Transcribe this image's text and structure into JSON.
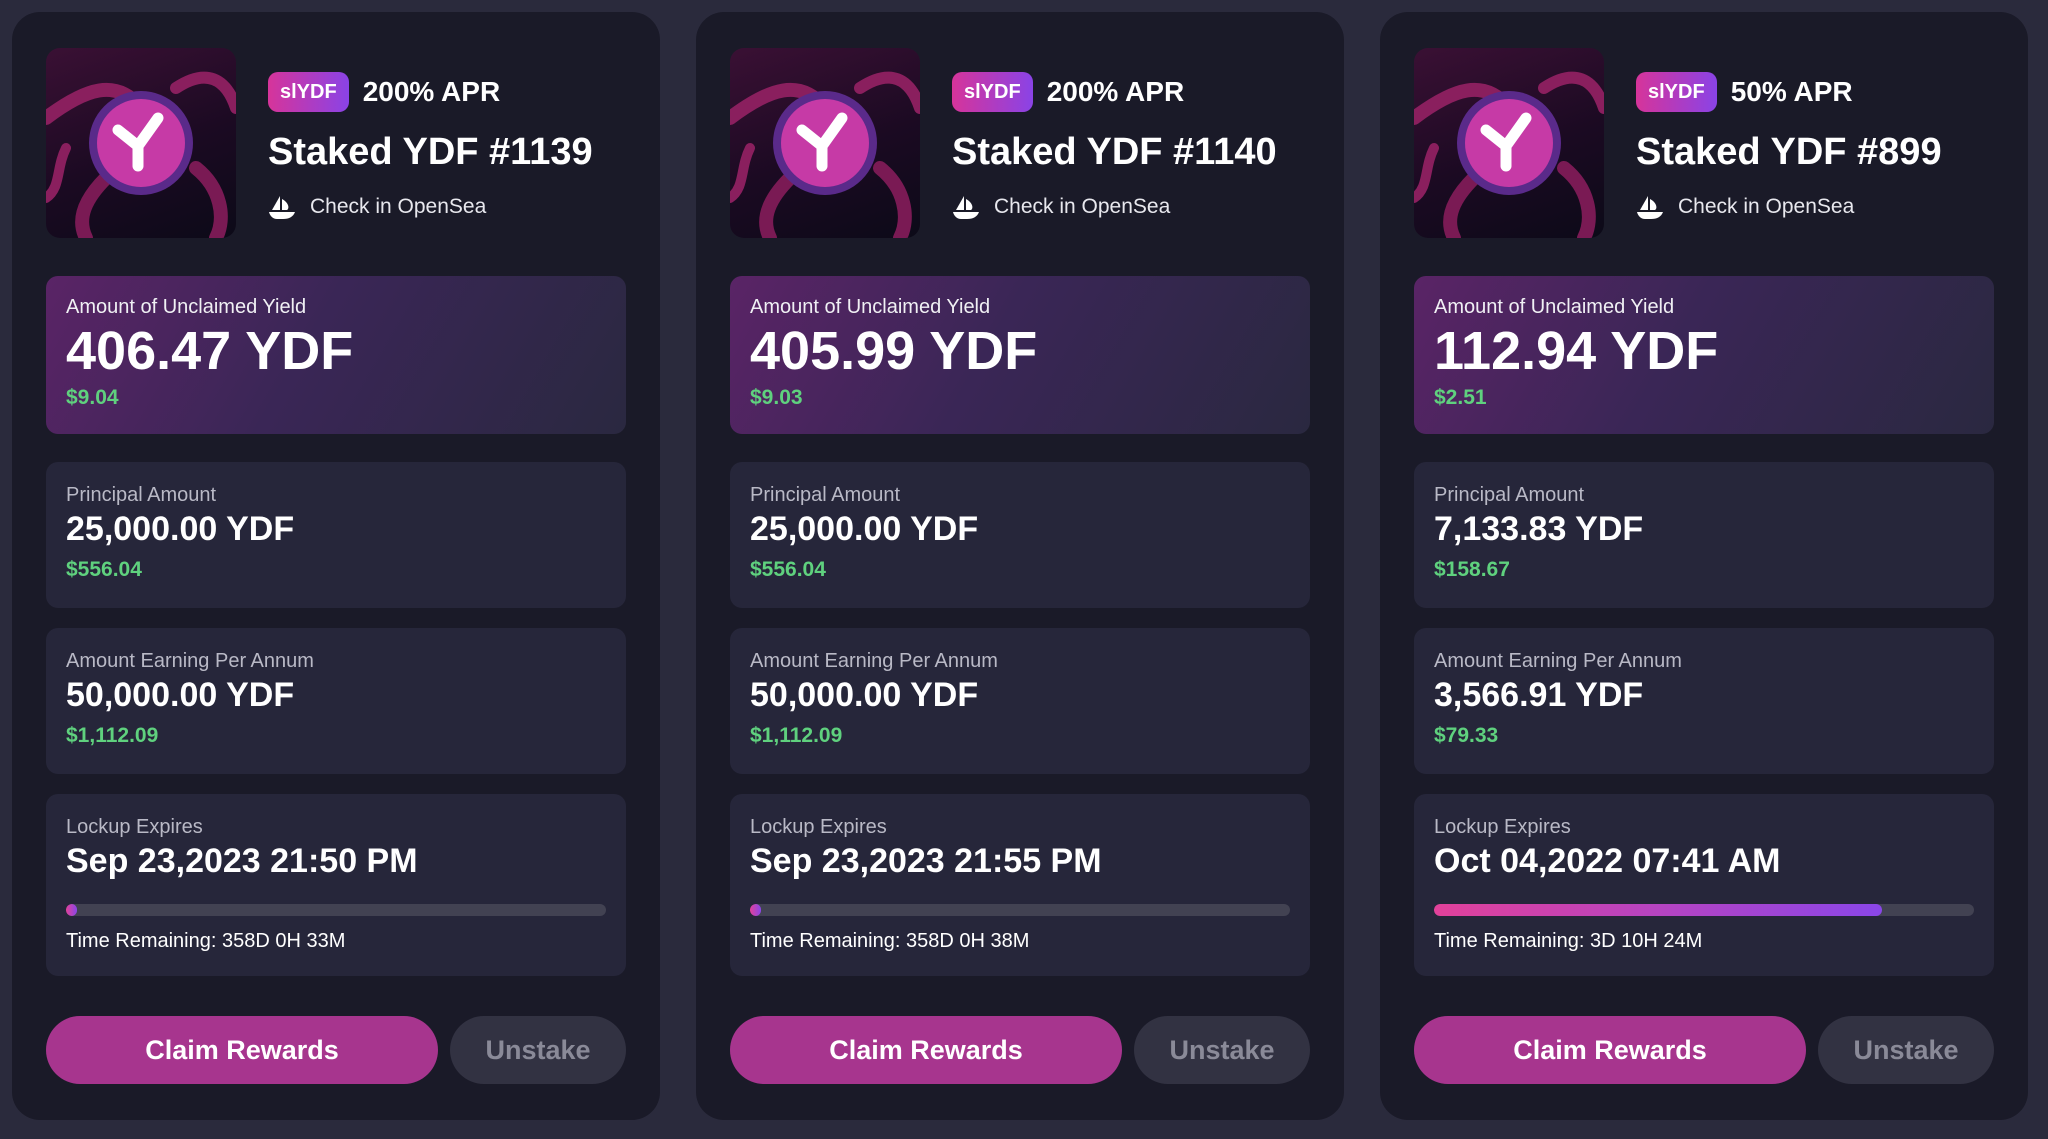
{
  "colors": {
    "page_bg": "#2a2a3c",
    "card_bg": "#1a1a28",
    "usd_green": "#5fd17e",
    "claim_button": "#a7358e",
    "badge_gradient_start": "#d6349a",
    "badge_gradient_end": "#8a43e6"
  },
  "labels": {
    "check_opensea": "Check in OpenSea",
    "unclaimed_yield": "Amount of Unclaimed Yield",
    "principal": "Principal Amount",
    "earning": "Amount Earning Per Annum",
    "lockup": "Lockup Expires",
    "claim": "Claim Rewards",
    "unstake": "Unstake"
  },
  "cards": [
    {
      "badge": "slYDF",
      "apr": "200% APR",
      "title": "Staked YDF #1139",
      "unclaimed_amount": "406.47 YDF",
      "unclaimed_usd": "$9.04",
      "principal_amount": "25,000.00 YDF",
      "principal_usd": "$556.04",
      "earning_amount": "50,000.00 YDF",
      "earning_usd": "$1,112.09",
      "lockup_date": "Sep 23,2023 21:50 PM",
      "lockup_progress": 0.02,
      "time_remaining": "Time Remaining: 358D 0H 33M",
      "icon": "yieldfi-logo-icon"
    },
    {
      "badge": "slYDF",
      "apr": "200% APR",
      "title": "Staked YDF #1140",
      "unclaimed_amount": "405.99 YDF",
      "unclaimed_usd": "$9.03",
      "principal_amount": "25,000.00 YDF",
      "principal_usd": "$556.04",
      "earning_amount": "50,000.00 YDF",
      "earning_usd": "$1,112.09",
      "lockup_date": "Sep 23,2023 21:55 PM",
      "lockup_progress": 0.02,
      "time_remaining": "Time Remaining: 358D 0H 38M",
      "icon": "yieldfi-logo-icon"
    },
    {
      "badge": "slYDF",
      "apr": "50% APR",
      "title": "Staked YDF #899",
      "unclaimed_amount": "112.94 YDF",
      "unclaimed_usd": "$2.51",
      "principal_amount": "7,133.83 YDF",
      "principal_usd": "$158.67",
      "earning_amount": "3,566.91 YDF",
      "earning_usd": "$79.33",
      "lockup_date": "Oct 04,2022 07:41 AM",
      "lockup_progress": 0.83,
      "time_remaining": "Time Remaining: 3D 10H 24M",
      "icon": "yieldfi-logo-icon"
    }
  ]
}
